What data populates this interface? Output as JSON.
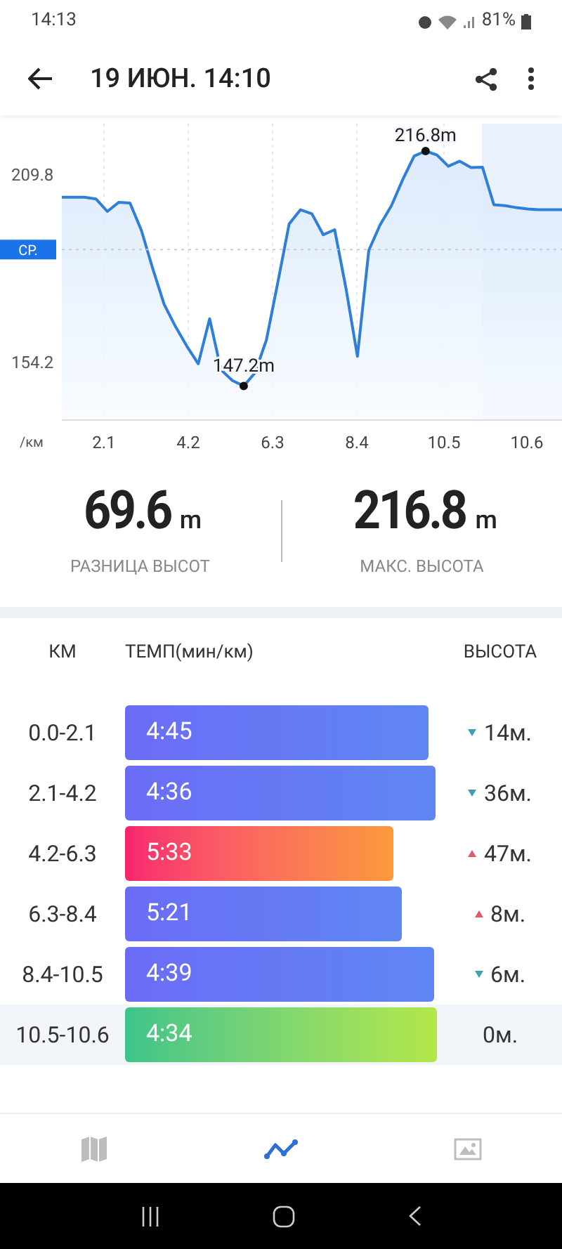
{
  "status_bar": {
    "time": "14:13",
    "battery": "81%"
  },
  "app_bar": {
    "title": "19 ИЮН. 14:10"
  },
  "elevation_chart": {
    "x_unit": "/км",
    "x_labels": [
      "2.1",
      "4.2",
      "6.3",
      "8.4",
      "10.5",
      "10.6"
    ],
    "chart_data": {
      "type": "area",
      "grid": true,
      "series": [
        {
          "color": "#2f7fd8",
          "values": [
            203.1,
            203.1,
            203.1,
            202.6,
            198.9,
            201.6,
            201.4,
            193.3,
            182.0,
            171.4,
            164.8,
            159.0,
            153.8,
            167.1,
            152.0,
            148.8,
            147.2,
            151.1,
            160.8,
            177.8,
            195.2,
            199.4,
            198.2,
            192.0,
            193.5,
            176.0,
            156.0,
            187.4,
            194.9,
            200.6,
            208.4,
            215.3,
            216.8,
            215.6,
            212.3,
            213.8,
            211.9,
            212.0,
            200.9,
            200.6,
            200.0,
            199.6,
            199.4,
            199.4,
            199.4
          ]
        }
      ],
      "ylim": [
        137.1,
        224.9
      ],
      "yticks": [
        {
          "value": 209.8,
          "label": "209.8"
        },
        {
          "value": 154.2,
          "label": "154.2"
        }
      ],
      "ref_lines": [
        {
          "axis": "y",
          "value": 187.6,
          "label": "СР."
        }
      ],
      "annotations": [
        {
          "text": "216.8m"
        },
        {
          "text": "147.2m"
        }
      ]
    }
  },
  "stats": [
    {
      "value": "69.6",
      "unit": "m",
      "label": "РАЗНИЦА ВЫСОТ"
    },
    {
      "value": "216.8",
      "unit": "m",
      "label": "МАКС. ВЫСОТА"
    }
  ],
  "splits": {
    "columns": [
      "КМ",
      "ТЕМП(мин/км)",
      "ВЫСОТА"
    ],
    "rows": [
      {
        "km": "0.0-2.1",
        "pace": "4:45",
        "kind": "normal",
        "elevation": {
          "kind": "down",
          "text": "14м."
        },
        "selected": false
      },
      {
        "km": "2.1-4.2",
        "pace": "4:36",
        "kind": "normal",
        "elevation": {
          "kind": "down",
          "text": "36м."
        },
        "selected": false
      },
      {
        "km": "4.2-6.3",
        "pace": "5:33",
        "kind": "slowest",
        "elevation": {
          "kind": "up",
          "text": "47м."
        },
        "selected": false
      },
      {
        "km": "6.3-8.4",
        "pace": "5:21",
        "kind": "normal",
        "elevation": {
          "kind": "up",
          "text": "8м."
        },
        "selected": false
      },
      {
        "km": "8.4-10.5",
        "pace": "4:39",
        "kind": "normal",
        "elevation": {
          "kind": "down",
          "text": "6м."
        },
        "selected": false
      },
      {
        "km": "10.5-10.6",
        "pace": "4:34",
        "kind": "fastest",
        "elevation": {
          "kind": "flat",
          "text": "0м."
        },
        "selected": true
      }
    ]
  },
  "bottom_tabs": [
    {
      "kind": "map",
      "selected": false
    },
    {
      "kind": "chart",
      "selected": true
    },
    {
      "kind": "photo",
      "selected": false
    }
  ]
}
